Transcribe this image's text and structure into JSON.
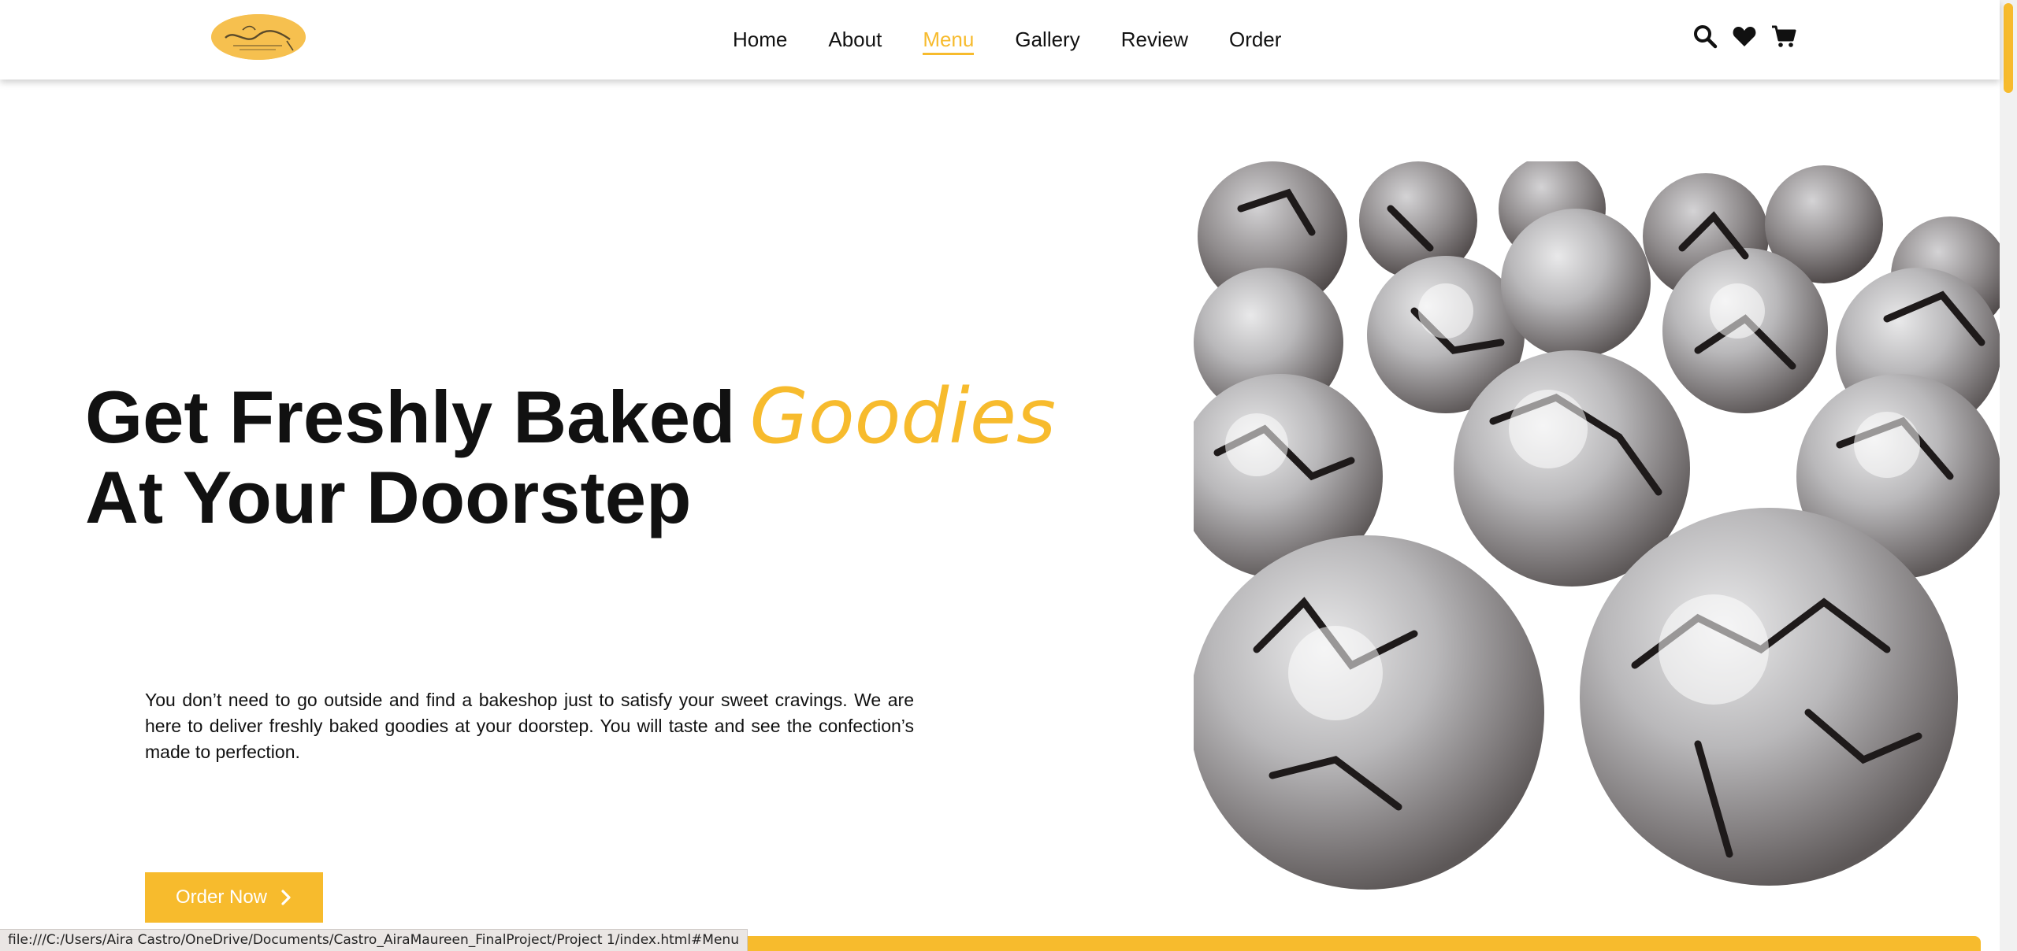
{
  "nav": {
    "items": [
      {
        "label": "Home"
      },
      {
        "label": "About"
      },
      {
        "label": "Menu"
      },
      {
        "label": "Gallery"
      },
      {
        "label": "Review"
      },
      {
        "label": "Order"
      }
    ],
    "active": "Menu"
  },
  "header_icons": [
    "search-icon",
    "heart-icon",
    "cart-icon"
  ],
  "hero": {
    "title_line1": "Get Freshly Baked",
    "title_accent": "Goodies",
    "title_line2": "At Your Doorstep",
    "description": "You don’t need to go outside and find a bakeshop just to satisfy your sweet cravings. We are here to deliver freshly baked goodies at your doorstep. You will taste and see the confection’s made to perfection.",
    "cta_label": "Order Now"
  },
  "status_bar": {
    "url": "file:///C:/Users/Aira Castro/OneDrive/Documents/Castro_AiraMaureen_FinalProject/Project 1/index.html#Menu"
  },
  "colors": {
    "accent": "#f7bb2d",
    "text": "#111111",
    "background": "#ffffff"
  }
}
